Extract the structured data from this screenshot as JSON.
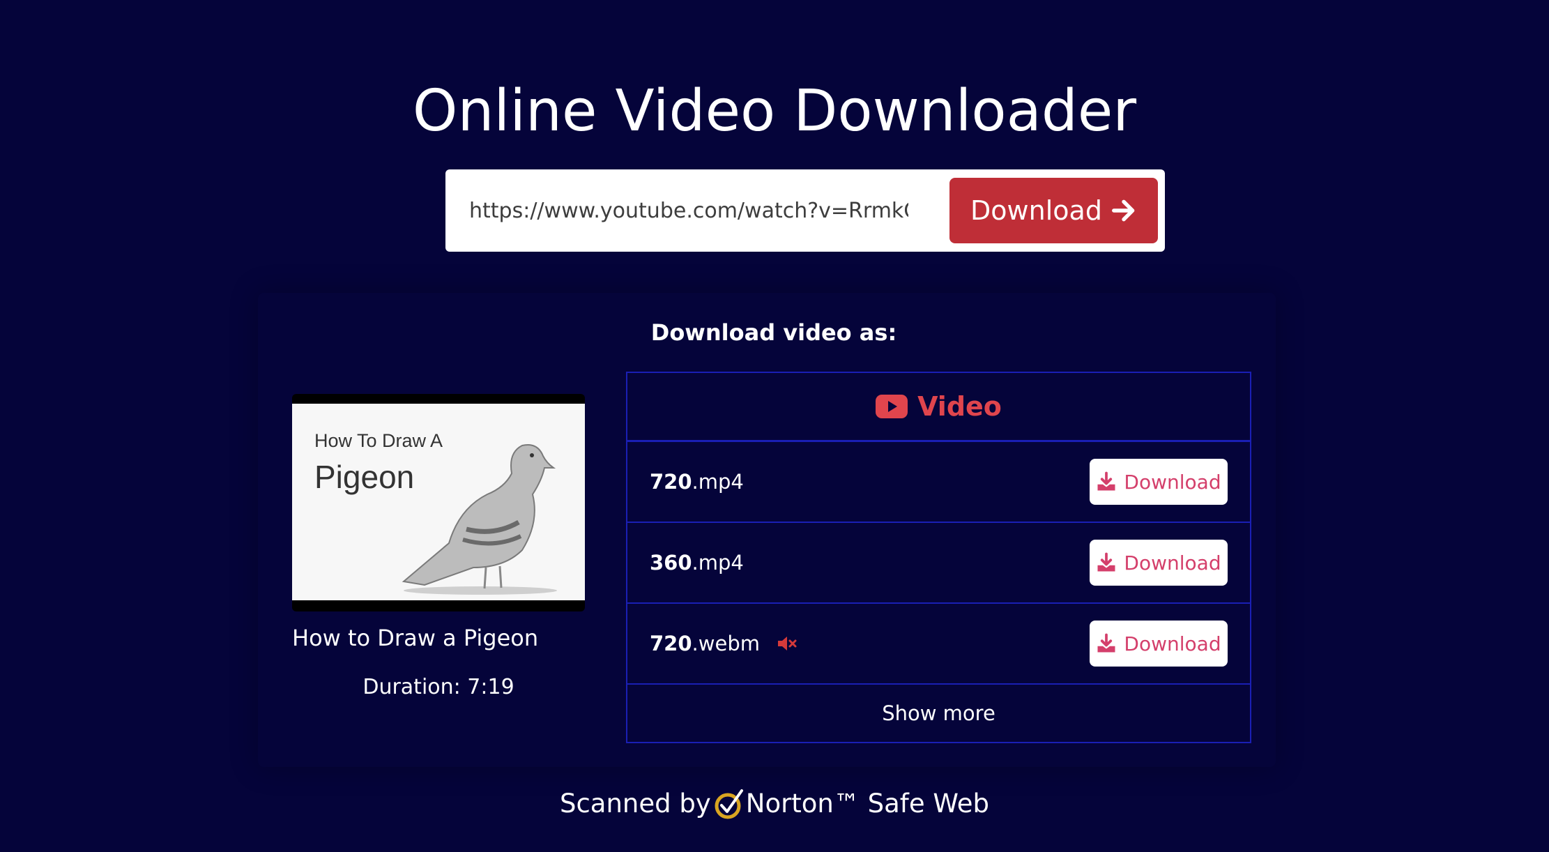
{
  "header": {
    "title": "Online Video Downloader"
  },
  "search": {
    "url_value": "https://www.youtube.com/watch?v=RrmkOtVs",
    "download_label": "Download"
  },
  "result": {
    "heading": "Download video as:",
    "thumbnail": {
      "line1": "How To Draw A",
      "line2": "Pigeon"
    },
    "video_title": "How to Draw a Pigeon",
    "duration": "Duration: 7:19",
    "formats_header": "Video",
    "formats": [
      {
        "quality": "720",
        "ext": ".mp4",
        "muted": false,
        "button_label": "Download"
      },
      {
        "quality": "360",
        "ext": ".mp4",
        "muted": false,
        "button_label": "Download"
      },
      {
        "quality": "720",
        "ext": ".webm",
        "muted": true,
        "button_label": "Download"
      }
    ],
    "show_more": "Show more"
  },
  "footer": {
    "scanned_by": "Scanned by",
    "norton": "Norton™ Safe Web"
  },
  "colors": {
    "background": "#05043a",
    "primary_button": "#bf2e37",
    "accent_red": "#e0454d",
    "download_pink": "#d43f6b",
    "table_border": "#1a1fb4"
  },
  "icons": [
    "arrow-right-icon",
    "youtube-icon",
    "download-icon",
    "mute-icon",
    "norton-check-icon"
  ]
}
